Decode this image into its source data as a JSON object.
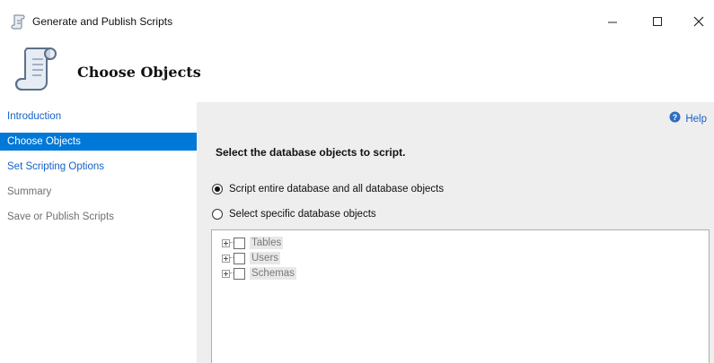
{
  "window": {
    "title": "Generate and Publish Scripts",
    "icons": {
      "app": "script-icon",
      "minimize": "minimize-icon",
      "maximize": "maximize-icon",
      "close": "close-icon"
    }
  },
  "header": {
    "title": "Choose Objects",
    "icon": "scroll-icon"
  },
  "sidebar": {
    "items": [
      {
        "label": "Introduction",
        "state": "link"
      },
      {
        "label": "Choose Objects",
        "state": "active"
      },
      {
        "label": "Set Scripting Options",
        "state": "link"
      },
      {
        "label": "Summary",
        "state": "disabled"
      },
      {
        "label": "Save or Publish Scripts",
        "state": "disabled"
      }
    ]
  },
  "main": {
    "help_label": "Help",
    "instruction": "Select the database objects to script.",
    "options": [
      {
        "label": "Script entire database and all database objects",
        "selected": true
      },
      {
        "label": "Select specific database objects",
        "selected": false
      }
    ],
    "tree": {
      "items": [
        {
          "label": "Tables",
          "checked": false
        },
        {
          "label": "Users",
          "checked": false
        },
        {
          "label": "Schemas",
          "checked": false
        }
      ]
    }
  },
  "colors": {
    "accent": "#0078d7",
    "link": "#1560c8",
    "panel_bg": "#eeeeee",
    "disabled_text": "#6f6f6f"
  }
}
